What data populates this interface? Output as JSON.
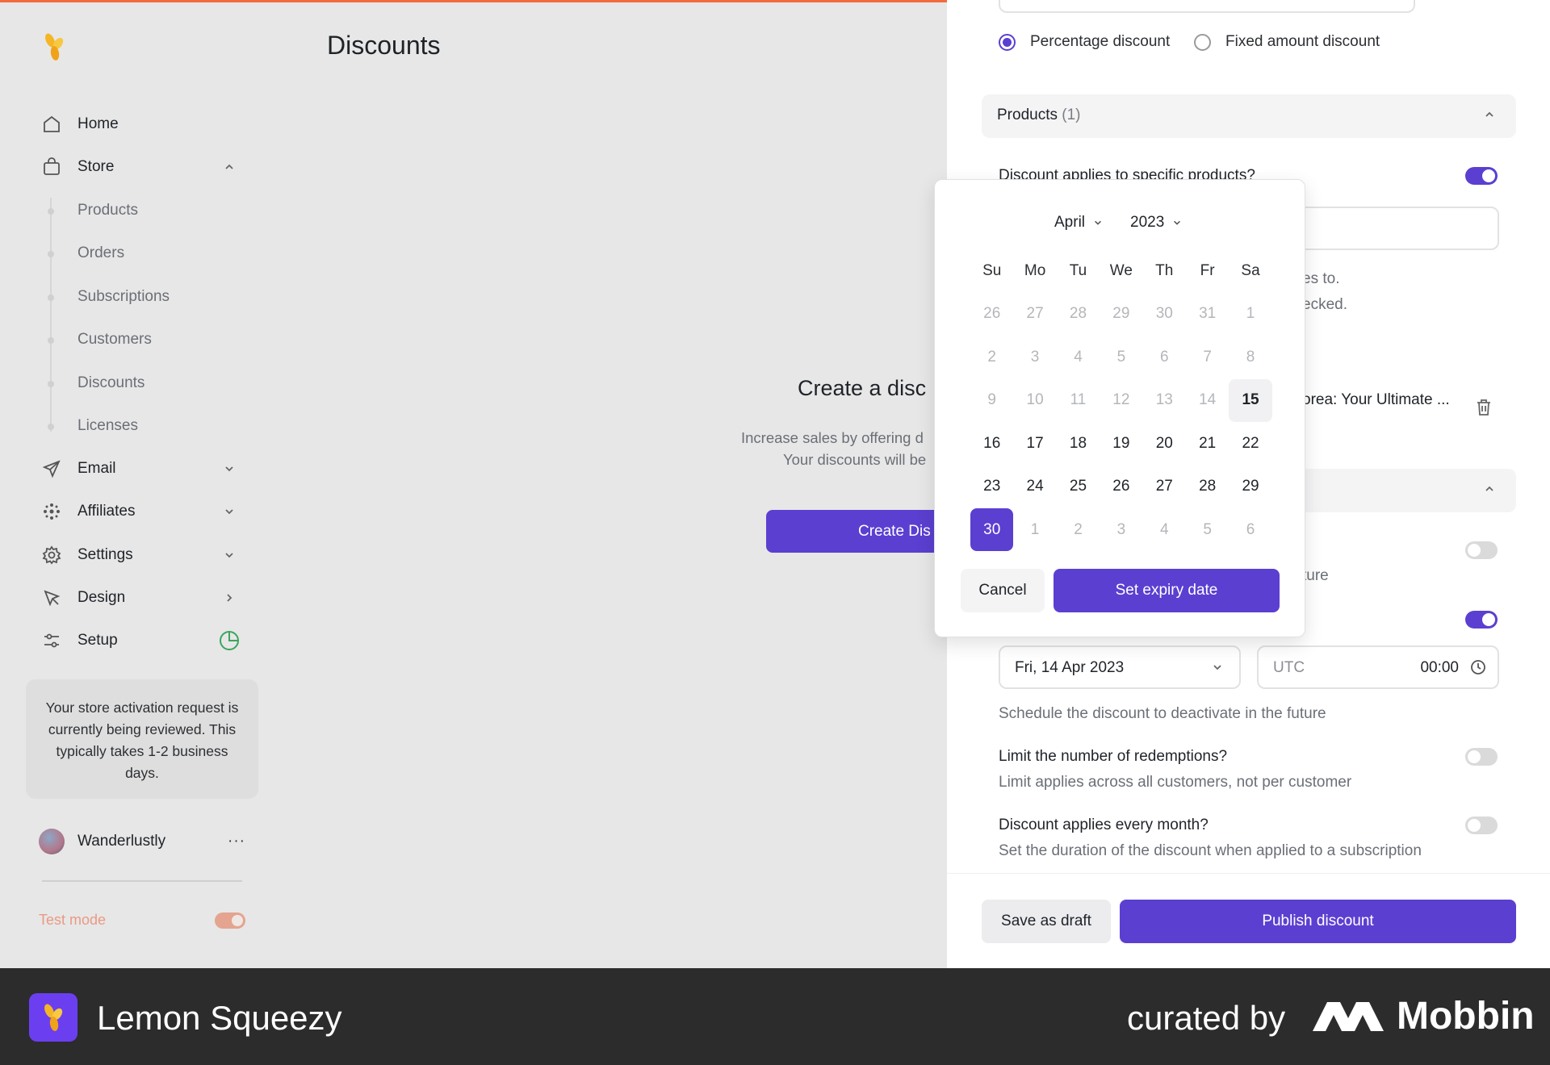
{
  "colors": {
    "accent": "#5b3fd1",
    "top_line": "#f26a3d",
    "brand_bar": "#2c2c2c"
  },
  "sidebar": {
    "logo_icon": "lemon-squeezy-logo",
    "nav": {
      "home": "Home",
      "store": "Store",
      "email": "Email",
      "affiliates": "Affiliates",
      "settings": "Settings",
      "design": "Design",
      "setup": "Setup"
    },
    "store_items": [
      "Products",
      "Orders",
      "Subscriptions",
      "Customers",
      "Discounts",
      "Licenses"
    ],
    "notice": "Your store activation request is currently being reviewed. This typically takes 1-2 business days.",
    "user_name": "Wanderlustly",
    "user_more": "···",
    "test_mode_label": "Test mode",
    "test_mode_on": true
  },
  "main": {
    "title": "Discounts",
    "empty_title": "Create a disc",
    "empty_desc_1": "Increase sales by offering d",
    "empty_desc_2": "Your discounts will be",
    "create_button": "Create Dis"
  },
  "panel": {
    "discount_type_options": [
      "Percentage discount",
      "Fixed amount discount"
    ],
    "discount_type_selected": "Percentage discount",
    "products_section_title": "Products",
    "products_count": "(1)",
    "specific_products_label": "Discount applies to specific products?",
    "specific_products_on": true,
    "help_fragment_1": "es to.",
    "help_fragment_2": "ecked.",
    "product_name": "orea: Your Ultimate ...",
    "toggle_row_1_on": false,
    "help_fragment_3": "ture",
    "expiry_toggle_on": true,
    "expiry_date_value": "Fri, 14 Apr 2023",
    "timezone_placeholder": "UTC",
    "expiry_time_value": "00:00",
    "expiry_help": "Schedule the discount to deactivate in the future",
    "limit_label": "Limit the number of redemptions?",
    "limit_help": "Limit applies across all customers, not per customer",
    "limit_on": false,
    "monthly_label": "Discount applies every month?",
    "monthly_help": "Set the duration of the discount when applied to a subscription",
    "monthly_on": false,
    "save_draft": "Save as draft",
    "publish": "Publish discount"
  },
  "datepicker": {
    "month": "April",
    "year": "2023",
    "weekdays": [
      "Su",
      "Mo",
      "Tu",
      "We",
      "Th",
      "Fr",
      "Sa"
    ],
    "weeks": [
      [
        "26",
        "27",
        "28",
        "29",
        "30",
        "31",
        "1"
      ],
      [
        "2",
        "3",
        "4",
        "5",
        "6",
        "7",
        "8"
      ],
      [
        "9",
        "10",
        "11",
        "12",
        "13",
        "14",
        "15"
      ],
      [
        "16",
        "17",
        "18",
        "19",
        "20",
        "21",
        "22"
      ],
      [
        "23",
        "24",
        "25",
        "26",
        "27",
        "28",
        "29"
      ],
      [
        "30",
        "1",
        "2",
        "3",
        "4",
        "5",
        "6"
      ]
    ],
    "today": "15",
    "selected": "30",
    "cancel": "Cancel",
    "confirm": "Set expiry date"
  },
  "brandbar": {
    "app_name": "Lemon Squeezy",
    "curated_by": "curated by",
    "mobbin": "Mobbin"
  }
}
